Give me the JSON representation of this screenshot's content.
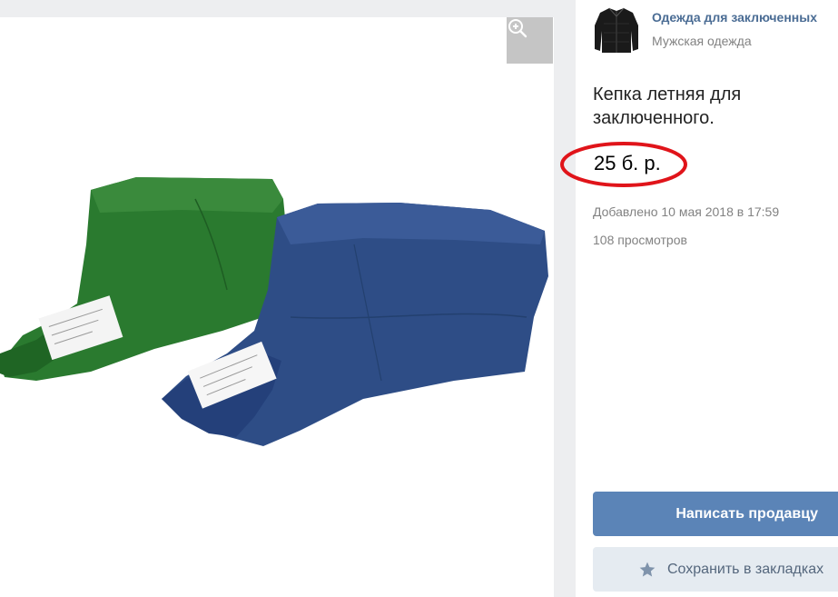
{
  "seller": {
    "name": "Одежда для заключенных",
    "category": "Мужская одежда",
    "avatar_icon": "jacket-icon"
  },
  "product": {
    "title": "Кепка летняя для заключенного.",
    "price": "25 б. р.",
    "added": "Добавлено 10 мая 2018 в 17:59",
    "views": "108 просмотров"
  },
  "photo": {
    "zoom_icon": "zoom-in-icon",
    "subject": [
      "green-cap",
      "blue-cap"
    ]
  },
  "actions": {
    "message_seller": "Написать продавцу",
    "save_bookmark": "Сохранить в закладках",
    "bookmark_icon": "star-icon"
  },
  "colors": {
    "accent": "#5b84b7",
    "link": "#4a6c94",
    "muted": "#828282",
    "highlight_circle": "#e0141a",
    "secondary_bg": "#e5ebf1"
  }
}
